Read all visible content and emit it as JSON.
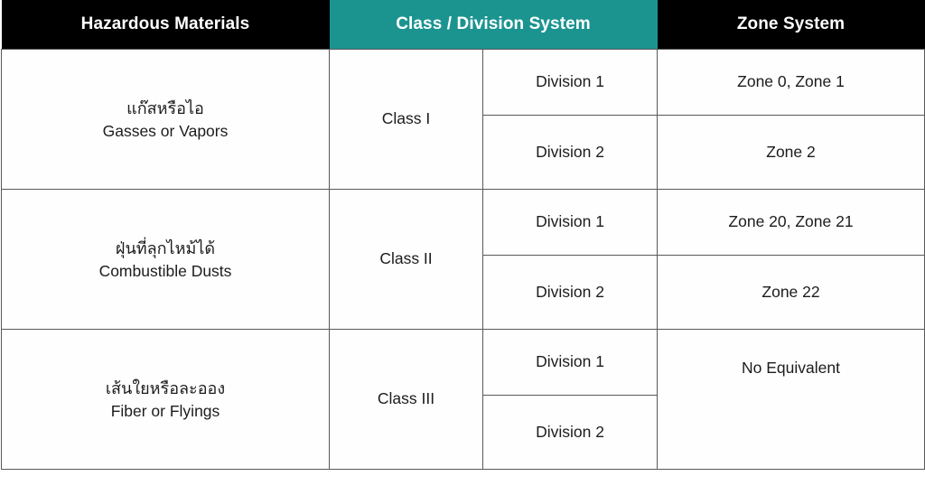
{
  "theme": {
    "header_black": "#000000",
    "header_teal": "#1b9490",
    "header_text": "#ffffff",
    "grid_line": "#59595b",
    "cell_bg": "#fefefe",
    "cell_text": "#1c1c1c"
  },
  "table": {
    "headers": {
      "materials": "Hazardous Materials",
      "class_division": "Class / Division System",
      "zone": "Zone System"
    },
    "rows": [
      {
        "material_thai": "แก๊สหรือไอ",
        "material_english": "Gasses or Vapors",
        "class": "Class I",
        "divisions": [
          {
            "division": "Division 1",
            "zone": "Zone 0, Zone 1"
          },
          {
            "division": "Division 2",
            "zone": "Zone 2"
          }
        ]
      },
      {
        "material_thai": "ฝุ่นที่ลุกไหม้ได้",
        "material_english": "Combustible Dusts",
        "class": "Class II",
        "divisions": [
          {
            "division": "Division 1",
            "zone": "Zone 20, Zone 21"
          },
          {
            "division": "Division 2",
            "zone": "Zone 22"
          }
        ]
      },
      {
        "material_thai": "เส้นใยหรือละออง",
        "material_english": "Fiber or Flyings",
        "class": "Class III",
        "zone_merged": "No Equivalent",
        "divisions": [
          {
            "division": "Division 1"
          },
          {
            "division": "Division 2"
          }
        ]
      }
    ]
  }
}
